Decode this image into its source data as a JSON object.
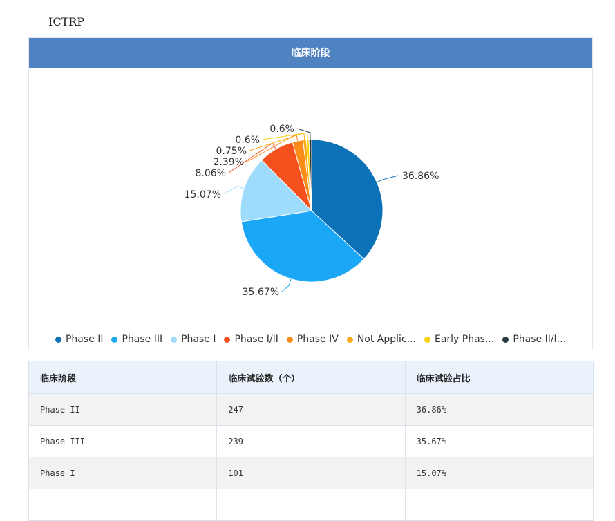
{
  "section_label": "ICTRP",
  "chart_data": {
    "type": "pie",
    "title": "临床阶段",
    "slices": [
      {
        "label": "Phase II",
        "legend": "Phase II",
        "value": 36.86,
        "display": "36.86%",
        "color": "#0c72b8"
      },
      {
        "label": "Phase III",
        "legend": "Phase III",
        "value": 35.67,
        "display": "35.67%",
        "color": "#1aa7f5"
      },
      {
        "label": "Phase I",
        "legend": "Phase I",
        "value": 15.07,
        "display": "15.07%",
        "color": "#9fdcfb"
      },
      {
        "label": "Phase I/II",
        "legend": "Phase I/II",
        "value": 8.06,
        "display": "8.06%",
        "color": "#f4511e"
      },
      {
        "label": "Phase IV",
        "legend": "Phase IV",
        "value": 2.39,
        "display": "2.39%",
        "color": "#fb8c1a"
      },
      {
        "label": "Not Applicable",
        "legend": "Not Applic...",
        "value": 0.75,
        "display": "0.75%",
        "color": "#fbab17"
      },
      {
        "label": "Early Phase",
        "legend": "Early Phas...",
        "value": 0.6,
        "display": "0.6%",
        "color": "#fad10b"
      },
      {
        "label": "Phase II/III",
        "legend": "Phase II/I...",
        "value": 0.6,
        "display": "0.6%",
        "color": "#2a3a44"
      }
    ],
    "legend_position": "bottom"
  },
  "table": {
    "headers": [
      "临床阶段",
      "临床试验数（个）",
      "临床试验占比"
    ],
    "rows": [
      [
        "Phase II",
        "247",
        "36.86%"
      ],
      [
        "Phase III",
        "239",
        "35.67%"
      ],
      [
        "Phase I",
        "101",
        "15.07%"
      ]
    ]
  }
}
